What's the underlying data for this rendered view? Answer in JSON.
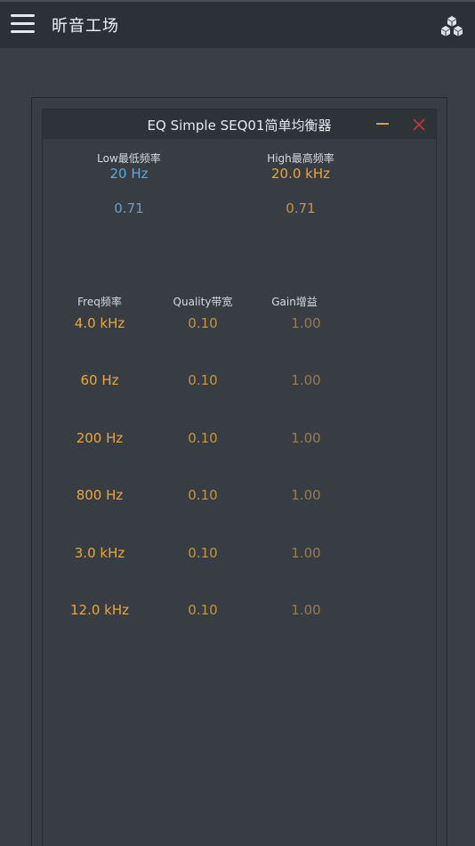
{
  "app": {
    "title": "昕音工场",
    "menu_icon": "hamburger-menu-icon",
    "cubes_icon": "cubes-icon"
  },
  "dialog": {
    "title": "EQ Simple SEQ01简单均衡器",
    "minimize_icon": "minimize-icon",
    "close_icon": "close-icon"
  },
  "low": {
    "label": "Low最低频率",
    "freq": "20 Hz",
    "q": "0.71"
  },
  "high": {
    "label": "High最高频率",
    "freq": "20.0 kHz",
    "q": "0.71"
  },
  "bands": {
    "headers": {
      "freq": "Freq频率",
      "quality": "Quality带宽",
      "gain": "Gain增益"
    },
    "rows": [
      {
        "freq": "4.0 kHz",
        "quality": "0.10",
        "gain": "1.00"
      },
      {
        "freq": "60 Hz",
        "quality": "0.10",
        "gain": "1.00"
      },
      {
        "freq": "200 Hz",
        "quality": "0.10",
        "gain": "1.00"
      },
      {
        "freq": "800 Hz",
        "quality": "0.10",
        "gain": "1.00"
      },
      {
        "freq": "3.0 kHz",
        "quality": "0.10",
        "gain": "1.00"
      },
      {
        "freq": "12.0 kHz",
        "quality": "0.10",
        "gain": "1.00"
      }
    ]
  },
  "colors": {
    "background": "#3a3f45",
    "topbar": "#2c3137",
    "accent_blue": "#5fa9d6",
    "accent_orange": "#e8a63d",
    "close_red": "#c0392b"
  }
}
